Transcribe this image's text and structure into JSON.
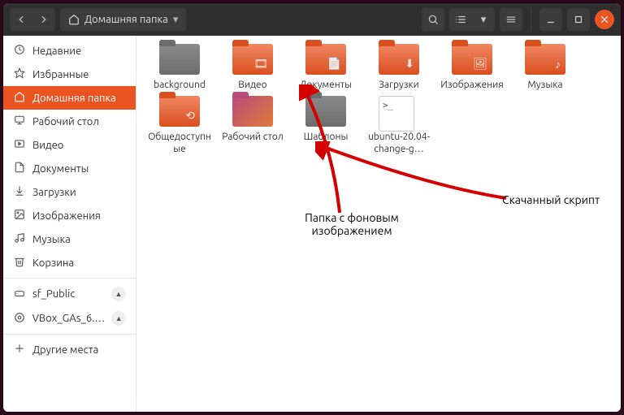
{
  "colors": {
    "accent": "#e95420"
  },
  "titlebar": {
    "breadcrumb_label": "Домашняя папка"
  },
  "sidebar": {
    "items": [
      {
        "icon": "clock",
        "label": "Недавние"
      },
      {
        "icon": "star",
        "label": "Избранные"
      },
      {
        "icon": "home",
        "label": "Домашняя папка",
        "active": true
      },
      {
        "icon": "desktop",
        "label": "Рабочий стол"
      },
      {
        "icon": "video",
        "label": "Видео"
      },
      {
        "icon": "doc",
        "label": "Документы"
      },
      {
        "icon": "download",
        "label": "Загрузки"
      },
      {
        "icon": "image",
        "label": "Изображения"
      },
      {
        "icon": "music",
        "label": "Музыка"
      },
      {
        "icon": "trash",
        "label": "Корзина"
      },
      {
        "icon": "drive",
        "label": "sf_Public",
        "eject": true
      },
      {
        "icon": "disc",
        "label": "VBox_GAs_6.…",
        "eject": true
      },
      {
        "icon": "plus",
        "label": "Другие места"
      }
    ],
    "divider_after": [
      9,
      11
    ]
  },
  "grid": {
    "items": [
      {
        "type": "folder",
        "tint": "grey",
        "glyph": "",
        "label": "background"
      },
      {
        "type": "folder",
        "glyph": "🎞",
        "label": "Видео"
      },
      {
        "type": "folder",
        "glyph": "📄",
        "label": "Документы"
      },
      {
        "type": "folder",
        "glyph": "⬇",
        "label": "Загрузки"
      },
      {
        "type": "folder",
        "glyph": "🖼",
        "label": "Изображения"
      },
      {
        "type": "folder",
        "glyph": "♪",
        "label": "Музыка"
      },
      {
        "type": "folder",
        "glyph": "⟲",
        "label": "Общедоступные"
      },
      {
        "type": "folder",
        "tint": "gradient",
        "glyph": "",
        "label": "Рабочий стол"
      },
      {
        "type": "folder",
        "tint": "grey",
        "glyph": "",
        "label": "Шаблоны"
      },
      {
        "type": "file-sh",
        "label": "ubuntu-20.04-change-g…"
      }
    ]
  },
  "annotations": {
    "left": "Папка с фоновым изображением",
    "right": "Скачанный скрипт"
  }
}
